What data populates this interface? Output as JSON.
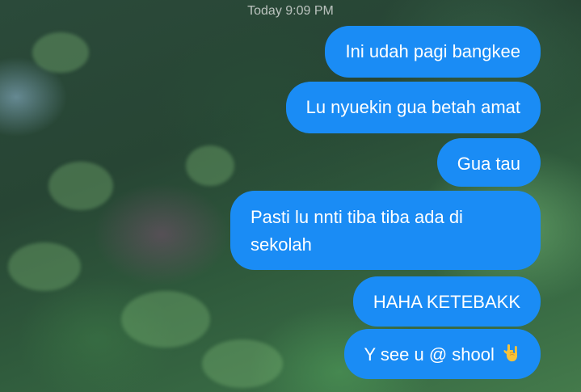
{
  "conversation": {
    "timestamp": "Today 9:09 PM",
    "messages": [
      {
        "text": "Ini udah pagi bangkee"
      },
      {
        "text": "Lu nyuekin gua betah amat"
      },
      {
        "text": "Gua tau"
      },
      {
        "text": "Pasti lu nnti tiba tiba ada di sekolah"
      },
      {
        "text": "HAHA KETEBAKK"
      },
      {
        "text": "Y see u @ shool",
        "emoji": "love-you-gesture-icon"
      }
    ]
  },
  "colors": {
    "bubble": "#1a8cf5",
    "bubble_text": "#ffffff",
    "timestamp_text": "#ebebeb"
  }
}
